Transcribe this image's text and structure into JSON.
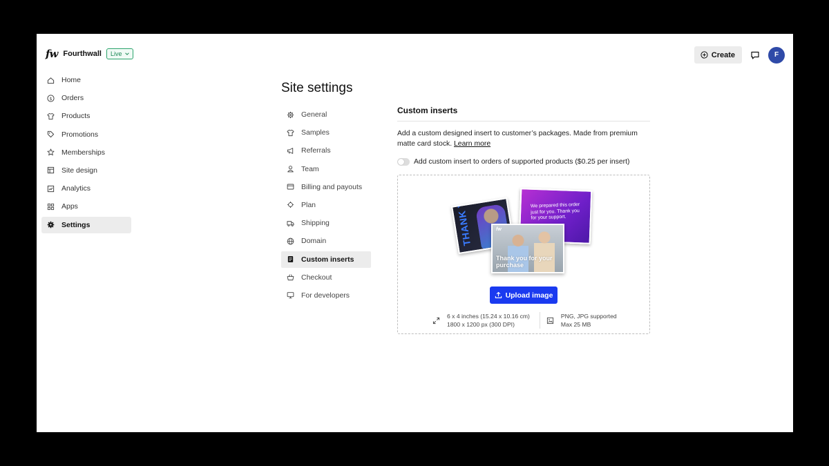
{
  "header": {
    "logo_text": "fw",
    "brand_name": "Fourthwall",
    "status_badge": "Live",
    "create_label": "Create",
    "avatar_initial": "F"
  },
  "sidebar": {
    "items": [
      {
        "label": "Home",
        "icon": "home-icon"
      },
      {
        "label": "Orders",
        "icon": "dollar-circle-icon"
      },
      {
        "label": "Products",
        "icon": "shirt-icon"
      },
      {
        "label": "Promotions",
        "icon": "tag-icon"
      },
      {
        "label": "Memberships",
        "icon": "star-icon"
      },
      {
        "label": "Site design",
        "icon": "layout-icon"
      },
      {
        "label": "Analytics",
        "icon": "chart-icon"
      },
      {
        "label": "Apps",
        "icon": "apps-grid-icon"
      },
      {
        "label": "Settings",
        "icon": "gear-icon",
        "active": true
      }
    ]
  },
  "page": {
    "title": "Site settings"
  },
  "settings_nav": {
    "items": [
      {
        "label": "General",
        "icon": "gear-outline-icon"
      },
      {
        "label": "Samples",
        "icon": "shirt-icon"
      },
      {
        "label": "Referrals",
        "icon": "megaphone-icon"
      },
      {
        "label": "Team",
        "icon": "person-icon"
      },
      {
        "label": "Billing and payouts",
        "icon": "card-icon"
      },
      {
        "label": "Plan",
        "icon": "puzzle-icon"
      },
      {
        "label": "Shipping",
        "icon": "truck-icon"
      },
      {
        "label": "Domain",
        "icon": "globe-icon"
      },
      {
        "label": "Custom inserts",
        "icon": "document-icon",
        "active": true
      },
      {
        "label": "Checkout",
        "icon": "basket-icon"
      },
      {
        "label": "For developers",
        "icon": "monitor-icon"
      }
    ]
  },
  "custom_inserts": {
    "section_title": "Custom inserts",
    "description": "Add a custom designed insert to customer’s packages. Made from premium matte card stock.",
    "learn_more": "Learn more",
    "toggle_label": "Add custom insert to orders of supported products ($0.25 per insert)",
    "toggle_on": false,
    "preview": {
      "card_dark_text": "THANK YOU",
      "card_purple_text": "We prepared this order just for you. Thank you for your support.",
      "card_photo_logo": "fw",
      "card_photo_text": "Thank you for your purchase"
    },
    "upload_label": "Upload image",
    "spec_size_line1": "6 x 4 inches (15.24 x 10.16 cm)",
    "spec_size_line2": "1800 x 1200 px (300 DPI)",
    "spec_format_line1": "PNG, JPG supported",
    "spec_format_line2": "Max 25 MB"
  },
  "colors": {
    "primary_button": "#1a3af0",
    "live_badge": "#1d8a57",
    "avatar": "#2f4aa8"
  }
}
